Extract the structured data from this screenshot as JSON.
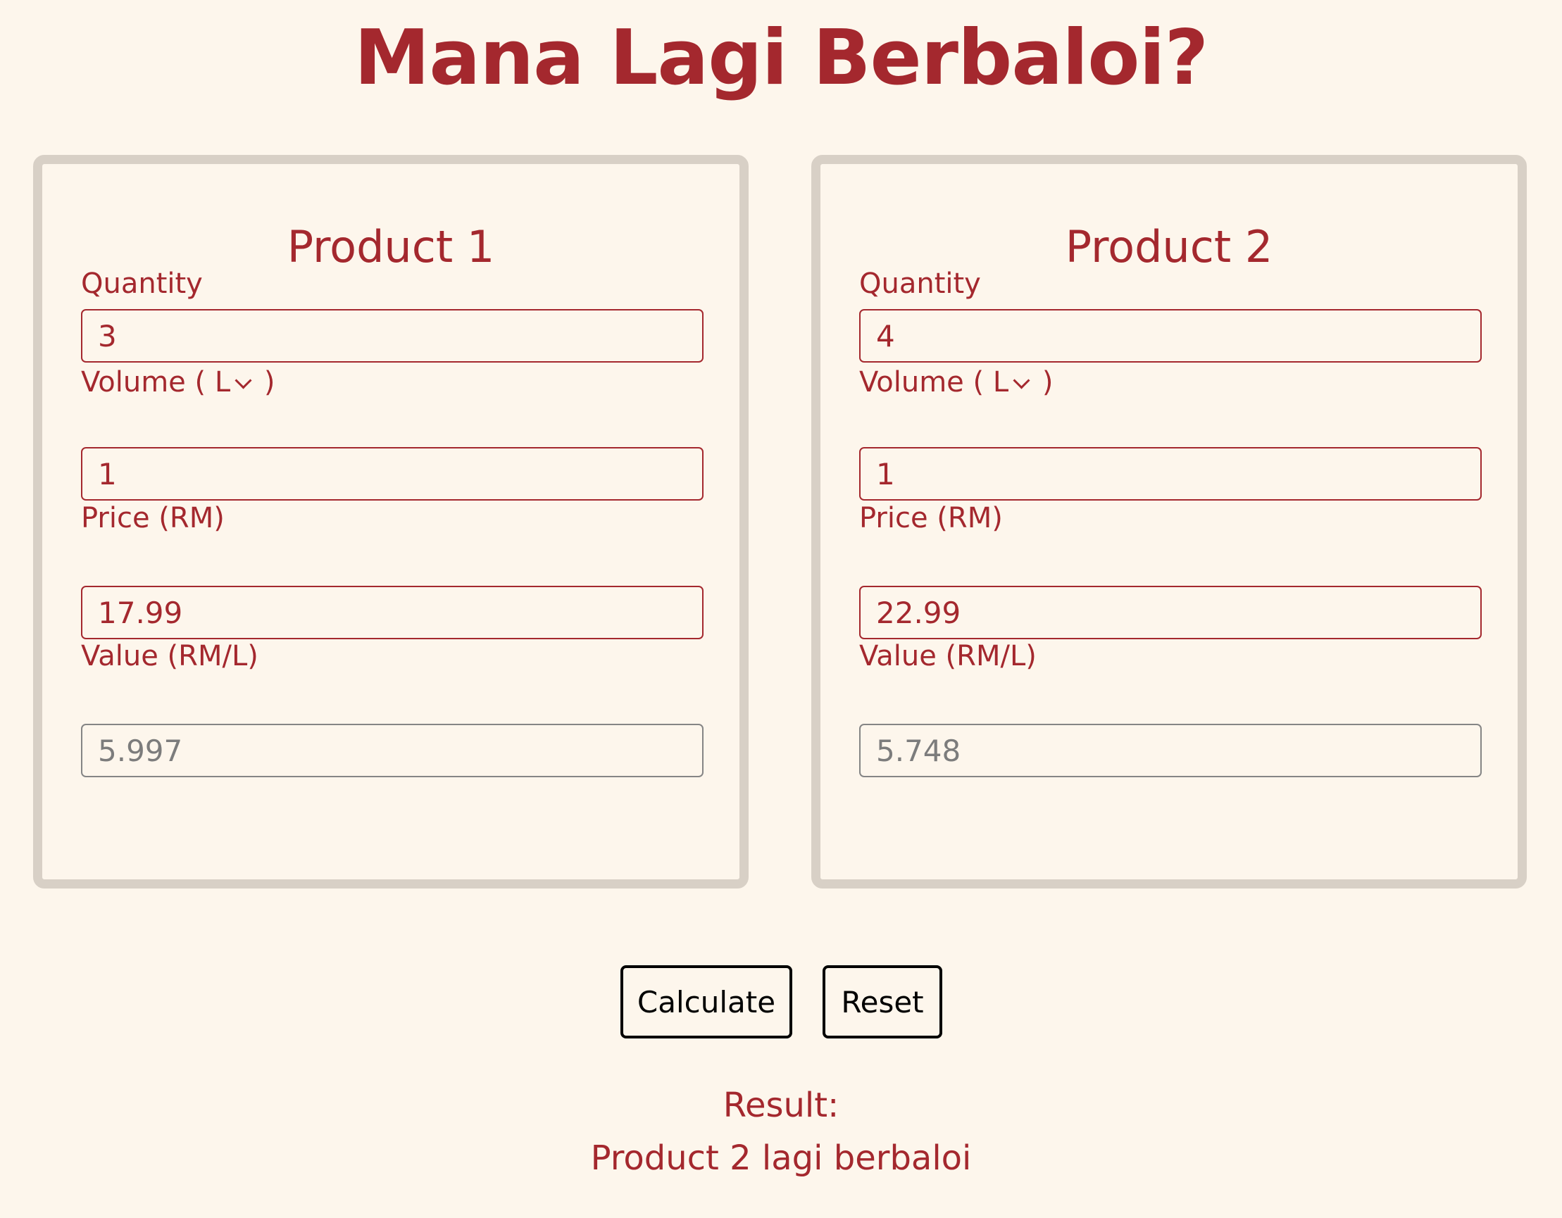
{
  "page": {
    "title": "Mana Lagi Berbaloi?"
  },
  "products": [
    {
      "title": "Product 1",
      "quantity_label": "Quantity",
      "quantity_value": "3",
      "volume_label_prefix": "Volume (",
      "volume_unit": "L",
      "volume_label_suffix": ")",
      "volume_value": "1",
      "price_label": "Price (RM)",
      "price_value": "17.99",
      "value_label": "Value (RM/L)",
      "value_value": "5.997"
    },
    {
      "title": "Product 2",
      "quantity_label": "Quantity",
      "quantity_value": "4",
      "volume_label_prefix": "Volume (",
      "volume_unit": "L",
      "volume_label_suffix": ")",
      "volume_value": "1",
      "price_label": "Price (RM)",
      "price_value": "22.99",
      "value_label": "Value (RM/L)",
      "value_value": "5.748"
    }
  ],
  "actions": {
    "calculate_label": "Calculate",
    "reset_label": "Reset"
  },
  "result": {
    "label": "Result:",
    "text": "Product 2 lagi berbaloi"
  },
  "colors": {
    "accent": "#a4282e",
    "background": "#fdf6ec",
    "card_border": "#d8d0c6",
    "readonly_text": "#7c7c7c"
  }
}
